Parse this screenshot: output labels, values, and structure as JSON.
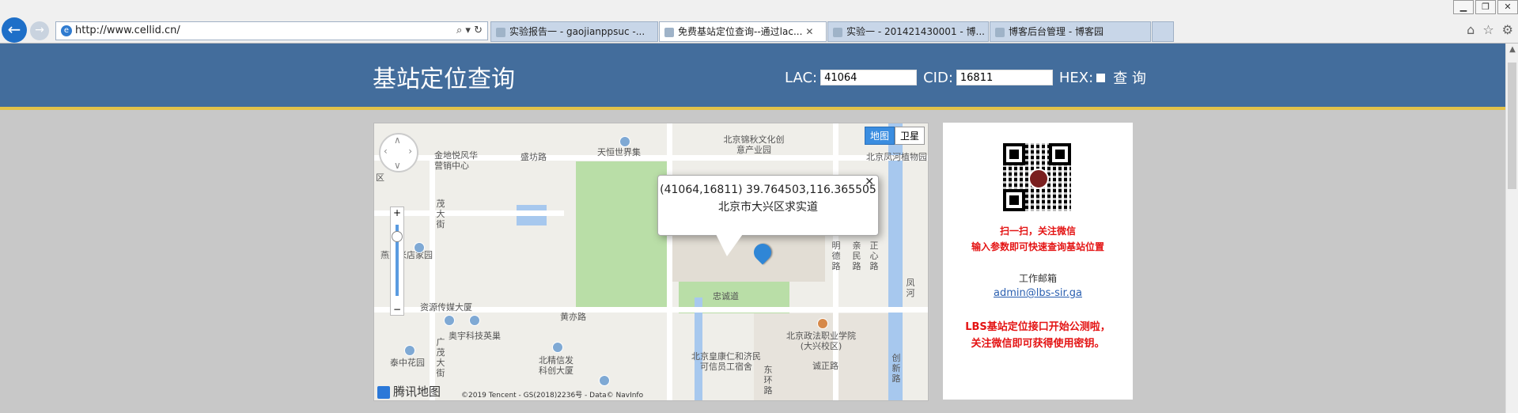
{
  "browser": {
    "address_url": "http://www.cellid.cn/",
    "tabs": [
      {
        "label": "实验报告一 - gaojianppsuc -...",
        "active": false
      },
      {
        "label": "免费基站定位查询--通过lac...",
        "active": true
      },
      {
        "label": "实验一 - 201421430001 - 博...",
        "active": false
      },
      {
        "label": "博客后台管理 - 博客园",
        "active": false
      }
    ],
    "close_glyph": "✕"
  },
  "header": {
    "title": "基站定位查询",
    "lac_label": "LAC:",
    "lac_value": "41064",
    "cid_label": "CID:",
    "cid_value": "16811",
    "hex_label": "HEX:",
    "query_label": "查 询"
  },
  "map": {
    "type_map": "地图",
    "type_satellite": "卫星",
    "popup_line1": "(41064,16811) 39.764503,116.365505",
    "popup_line2": "北京市大兴区求实道",
    "logo_text": "腾讯地图",
    "copyright": "©2019 Tencent - GS(2018)2236号 - Data© NavInfo",
    "labels": {
      "l1": "北京锦秋文化创意产业园",
      "l2": "金地悦风华营销中心",
      "l3": "盛坊路",
      "l4": "天恒世界集",
      "l5": "北京凤河植物园",
      "l6": "茂大街",
      "l7": "燕京米店家园",
      "l8": "资源传媒大厦",
      "l9": "黄亦路",
      "l10": "奥宇科技英巢",
      "l11": "北京政法职业学院(大兴校区)",
      "l12": "忠诚道",
      "l13": "北京皇康仁和济民可信员工宿舍",
      "l14": "北精信发科创大厦",
      "l15": "泰中花园",
      "l16": "诚正路",
      "l17": "明德路",
      "l18": "亲民路",
      "l19": "正心路",
      "l20": "凤河",
      "l21": "广茂大街",
      "l22": "创新路",
      "l23": "东环路",
      "l24": "黄亦路",
      "l25": "区"
    }
  },
  "side": {
    "scan_line1": "扫一扫，关注微信",
    "scan_line2": "输入参数即可快速查询基站位置",
    "email_label": "工作邮箱",
    "email": "admin@lbs-sir.ga",
    "notice_line1": "LBS基站定位接口开始公测啦，",
    "notice_line2": "关注微信即可获得使用密钥。"
  },
  "colors": {
    "header_bg": "#436d9c",
    "header_accent": "#e2c24a",
    "notice_red": "#e41414",
    "link_blue": "#2a5fb0"
  },
  "icons": {
    "back": "arrow-left-icon",
    "forward": "arrow-right-icon",
    "home": "home-icon",
    "favorites": "star-icon",
    "settings": "gear-icon"
  }
}
